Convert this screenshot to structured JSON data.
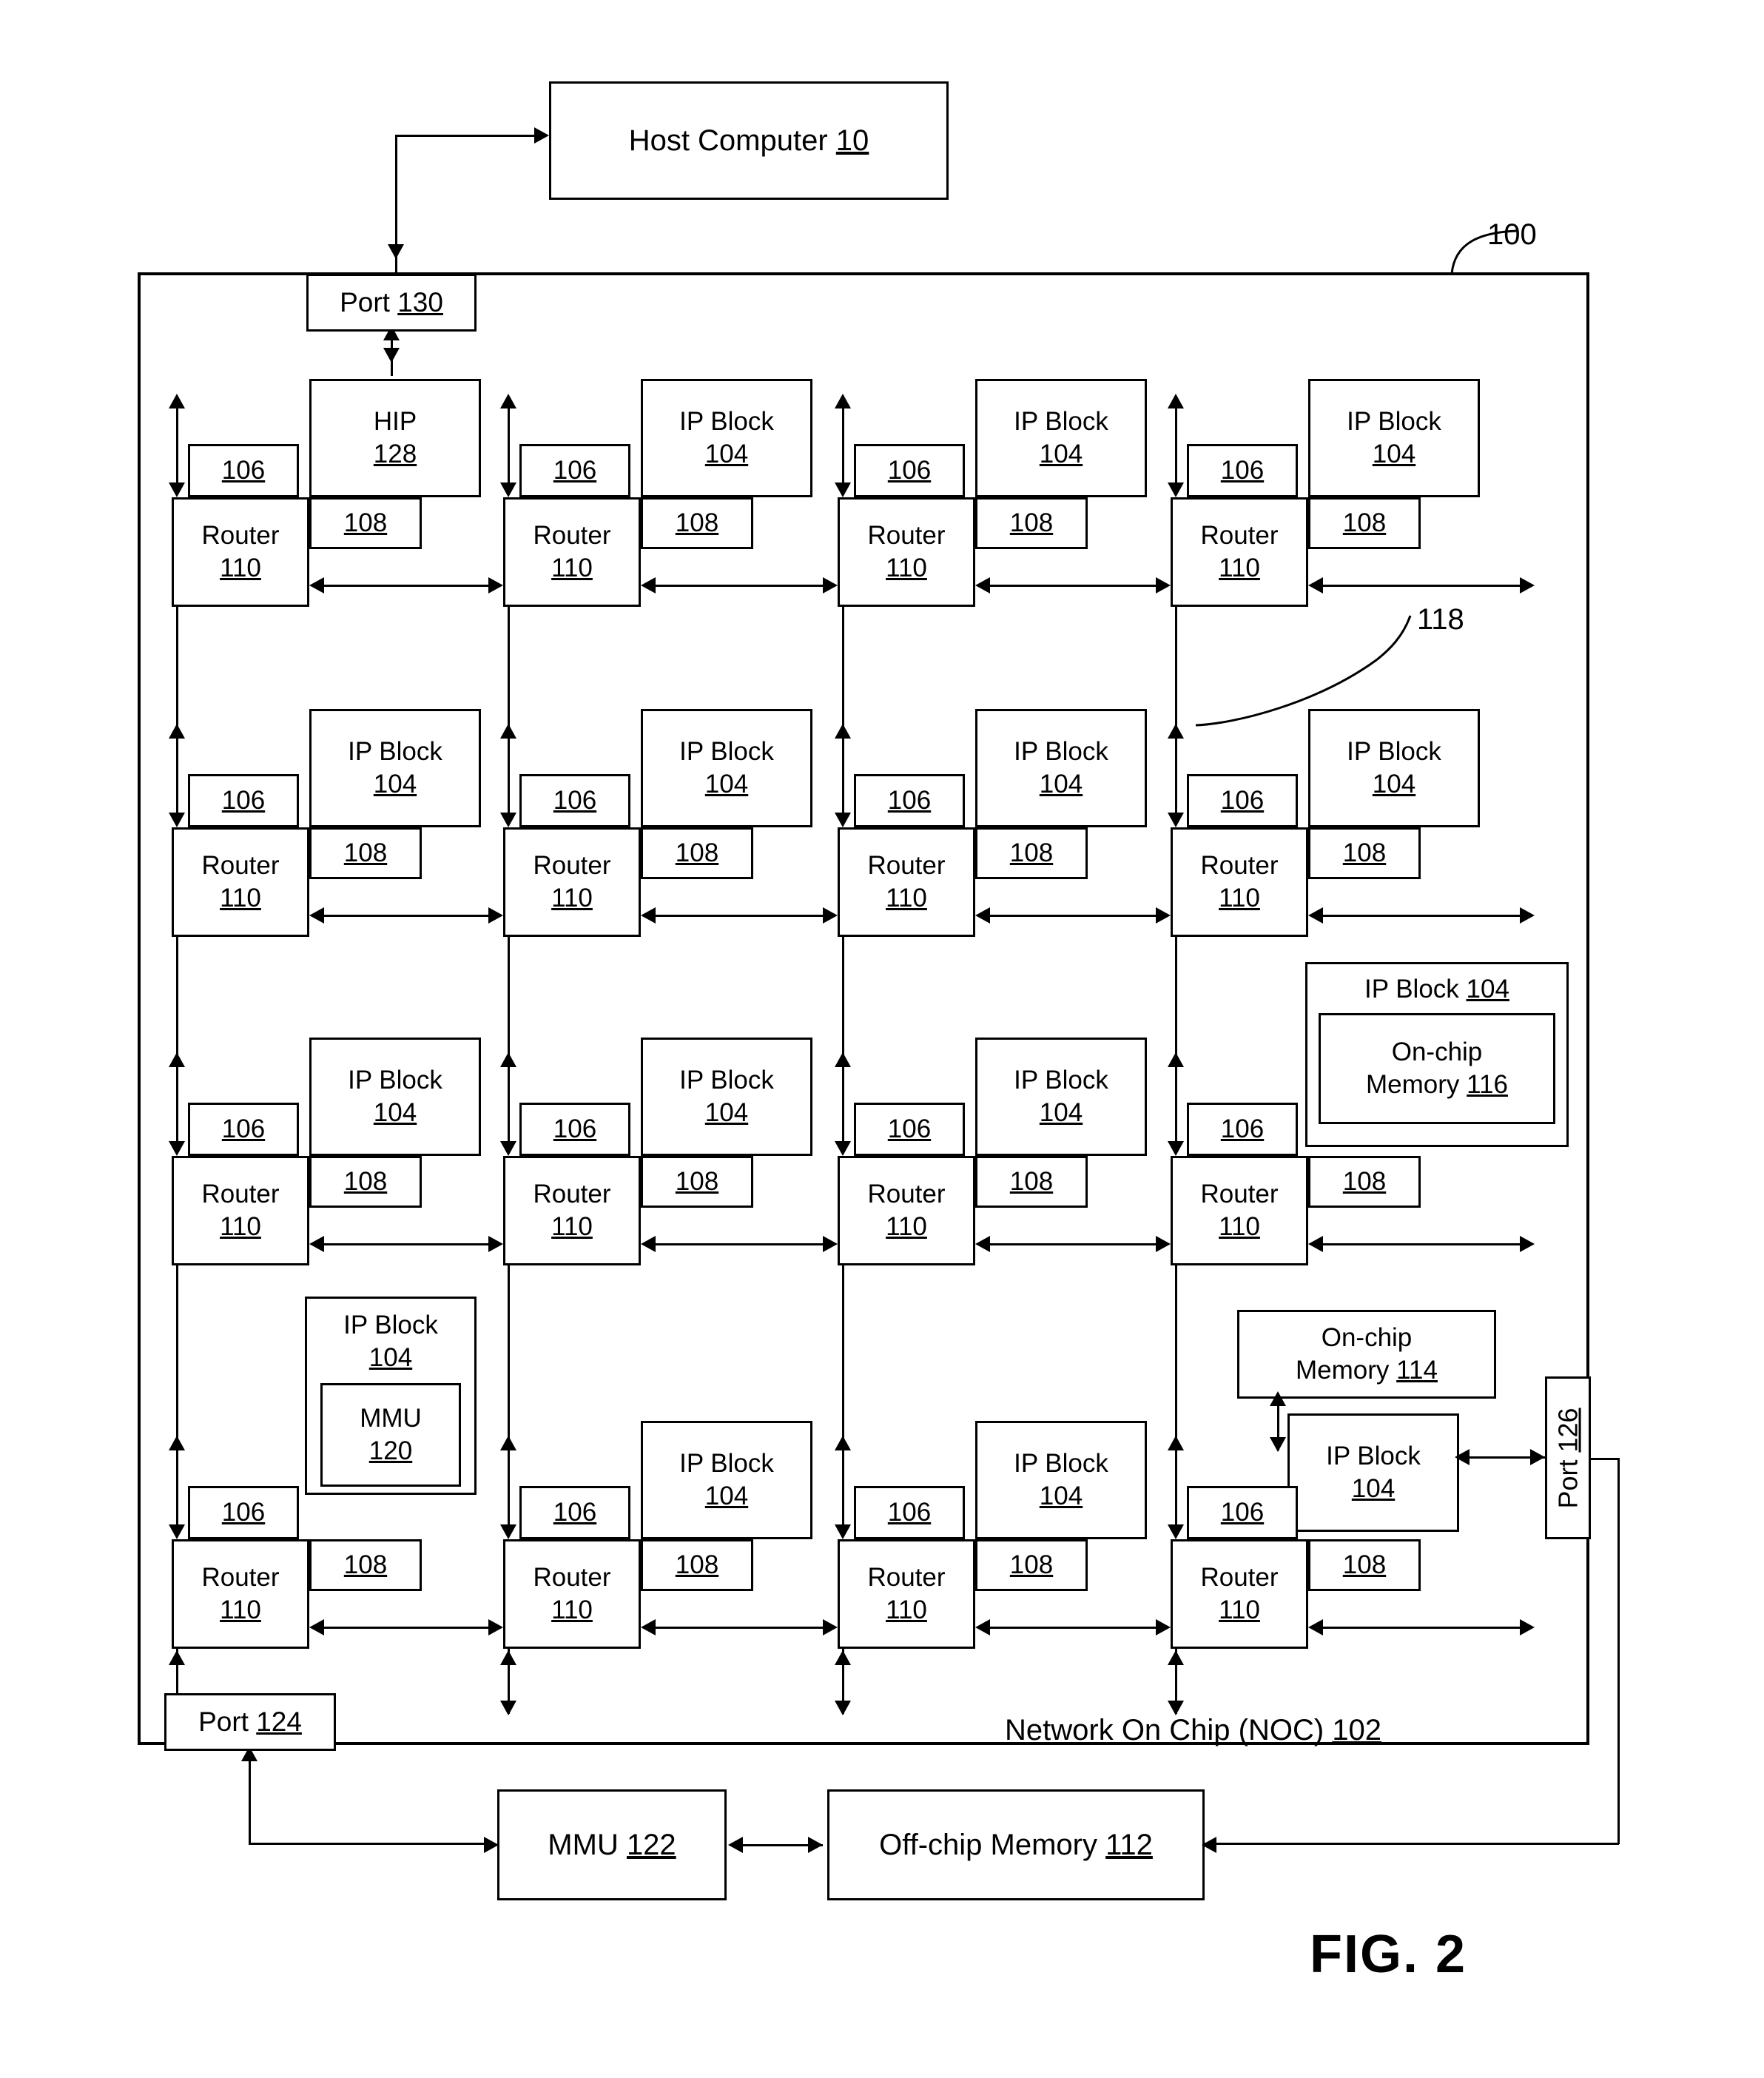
{
  "figure": {
    "label": "FIG. 2",
    "noc_callout": "100",
    "link_callout": "118",
    "noc_label": "Network On Chip (NOC) 102",
    "noc_label_text": "Network On Chip (NOC) ",
    "noc_label_num": "102"
  },
  "host": {
    "label": "Host Computer ",
    "num": "10"
  },
  "ports": {
    "top": {
      "label": "Port ",
      "num": "130"
    },
    "bottom": {
      "label": "Port ",
      "num": "124"
    },
    "right": {
      "label": "Port ",
      "num": "126"
    }
  },
  "labels": {
    "router": "Router",
    "router_num": "110",
    "link_106": "106",
    "link_108": "108",
    "ip_block": "IP Block",
    "ip_block_num": "104",
    "hip": "HIP",
    "hip_num": "128",
    "onchip_line1": "On-chip",
    "onchip_116": "Memory 116",
    "onchip_116_text": "Memory ",
    "onchip_116_num": "116",
    "onchip_114_text": "Memory ",
    "onchip_114_num": "114",
    "ip_block_inline": "IP Block ",
    "mmu": "MMU",
    "mmu_120_num": "120"
  },
  "bottom_blocks": {
    "mmu122": {
      "label": "MMU ",
      "num": "122"
    },
    "offchip112": {
      "label": "Off-chip  Memory ",
      "num": "112"
    }
  },
  "grid": {
    "rows": 4,
    "cols": 4,
    "cells": [
      [
        {
          "type": "hip",
          "link106": "106",
          "link108": "108",
          "router": "Router",
          "router_num": "110",
          "block_title": "HIP",
          "block_num": "128"
        },
        {
          "type": "ip",
          "link106": "106",
          "link108": "108",
          "router": "Router",
          "router_num": "110",
          "block_title": "IP Block",
          "block_num": "104"
        },
        {
          "type": "ip",
          "link106": "106",
          "link108": "108",
          "router": "Router",
          "router_num": "110",
          "block_title": "IP Block",
          "block_num": "104"
        },
        {
          "type": "ip",
          "link106": "106",
          "link108": "108",
          "router": "Router",
          "router_num": "110",
          "block_title": "IP Block",
          "block_num": "104"
        }
      ],
      [
        {
          "type": "ip",
          "link106": "106",
          "link108": "108",
          "router": "Router",
          "router_num": "110",
          "block_title": "IP Block",
          "block_num": "104"
        },
        {
          "type": "ip",
          "link106": "106",
          "link108": "108",
          "router": "Router",
          "router_num": "110",
          "block_title": "IP Block",
          "block_num": "104"
        },
        {
          "type": "ip",
          "link106": "106",
          "link108": "108",
          "router": "Router",
          "router_num": "110",
          "block_title": "IP Block",
          "block_num": "104"
        },
        {
          "type": "ip",
          "link106": "106",
          "link108": "108",
          "router": "Router",
          "router_num": "110",
          "block_title": "IP Block",
          "block_num": "104"
        }
      ],
      [
        {
          "type": "ip",
          "link106": "106",
          "link108": "108",
          "router": "Router",
          "router_num": "110",
          "block_title": "IP Block",
          "block_num": "104"
        },
        {
          "type": "ip",
          "link106": "106",
          "link108": "108",
          "router": "Router",
          "router_num": "110",
          "block_title": "IP Block",
          "block_num": "104"
        },
        {
          "type": "ip",
          "link106": "106",
          "link108": "108",
          "router": "Router",
          "router_num": "110",
          "block_title": "IP Block",
          "block_num": "104"
        },
        {
          "type": "onchip116",
          "link106": "106",
          "link108": "108",
          "router": "Router",
          "router_num": "110",
          "block_title": "IP Block 104",
          "block_num": "116"
        }
      ],
      [
        {
          "type": "mmu120",
          "link106": "106",
          "link108": "108",
          "router": "Router",
          "router_num": "110",
          "block_title": "IP Block",
          "block_num": "104",
          "inner": "MMU",
          "inner_num": "120"
        },
        {
          "type": "ip",
          "link106": "106",
          "link108": "108",
          "router": "Router",
          "router_num": "110",
          "block_title": "IP Block",
          "block_num": "104"
        },
        {
          "type": "ip",
          "link106": "106",
          "link108": "108",
          "router": "Router",
          "router_num": "110",
          "block_title": "IP Block",
          "block_num": "104"
        },
        {
          "type": "onchip114",
          "link106": "106",
          "link108": "108",
          "router": "Router",
          "router_num": "110",
          "block_title": "IP Block",
          "block_num": "104"
        }
      ]
    ]
  }
}
